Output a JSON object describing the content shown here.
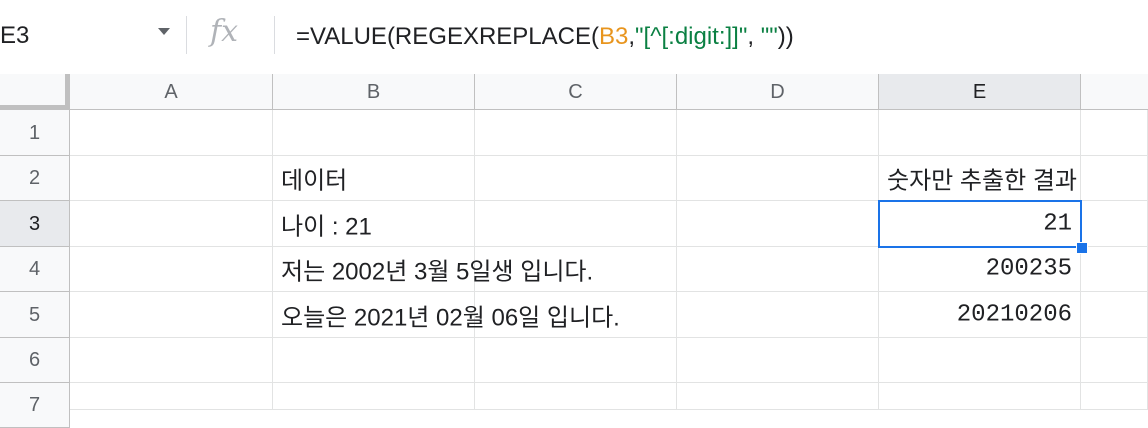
{
  "formula_bar": {
    "name_box": "E3",
    "fx_symbol": "fx",
    "formula": {
      "prefix": "=VALUE(REGEXREPLACE(",
      "ref": "B3",
      "comma1": ",",
      "pattern": "\"[^[:digit:]]\"",
      "comma2": ", ",
      "replacement": "\"\"",
      "suffix": "))"
    }
  },
  "columns": [
    "A",
    "B",
    "C",
    "D",
    "E"
  ],
  "rows": [
    "1",
    "2",
    "3",
    "4",
    "5",
    "6",
    "7"
  ],
  "cells": {
    "B2": "데이터",
    "E2": "숫자만 추출한 결과",
    "B3": "나이 : 21",
    "E3": "21",
    "B4": "저는 2002년 3월 5일생 입니다.",
    "E4": "200235",
    "B5": "오늘은 2021년 02월 06일 입니다.",
    "E5": "20210206"
  },
  "selected_cell": "E3",
  "colors": {
    "selection": "#1a73e8",
    "ref": "#e8951e",
    "string": "#0b8043"
  }
}
